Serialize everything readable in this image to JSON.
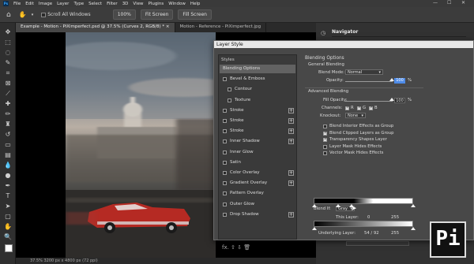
{
  "menubar": {
    "logo": "Ps",
    "items": [
      "File",
      "Edit",
      "Image",
      "Layer",
      "Type",
      "Select",
      "Filter",
      "3D",
      "View",
      "Plugins",
      "Window",
      "Help"
    ]
  },
  "optbar": {
    "scroll_all_label": "Scroll All Windows",
    "zoom_value": "100%",
    "fit_screen_1": "Fit Screen",
    "fit_screen_2": "Fill Screen"
  },
  "tabs": [
    {
      "label": "Example - Motion - PiXimperfect.psd @ 37.5% (Curves 2, RGB/8) * ×"
    },
    {
      "label": "Motion - Reference - PiXimperfect.jpg"
    }
  ],
  "statusbar": {
    "text": "37.5%    3200 px x 4800 px (72 ppi)"
  },
  "panel": {
    "navigator_label": "Navigator"
  },
  "dialog": {
    "title": "Layer Style",
    "styles_header": "Styles",
    "styles": [
      {
        "label": "Blending Options",
        "selected": true,
        "plus": false,
        "sub": false
      },
      {
        "label": "Bevel & Emboss",
        "plus": false,
        "sub": false
      },
      {
        "label": "Contour",
        "plus": false,
        "sub": true
      },
      {
        "label": "Texture",
        "plus": false,
        "sub": true
      },
      {
        "label": "Stroke",
        "plus": true,
        "sub": false
      },
      {
        "label": "Stroke",
        "plus": true,
        "sub": false
      },
      {
        "label": "Stroke",
        "plus": true,
        "sub": false
      },
      {
        "label": "Inner Shadow",
        "plus": true,
        "sub": false
      },
      {
        "label": "Inner Glow",
        "plus": false,
        "sub": false
      },
      {
        "label": "Satin",
        "plus": false,
        "sub": false
      },
      {
        "label": "Color Overlay",
        "plus": true,
        "sub": false
      },
      {
        "label": "Gradient Overlay",
        "plus": true,
        "sub": false
      },
      {
        "label": "Pattern Overlay",
        "plus": false,
        "sub": false
      },
      {
        "label": "Outer Glow",
        "plus": false,
        "sub": false
      },
      {
        "label": "Drop Shadow",
        "plus": true,
        "sub": false
      }
    ],
    "footer": "fx.  ⇧  ⇩        🗑",
    "blend": {
      "header": "Blending Options",
      "general": "General Blending",
      "blend_mode_label": "Blend Mode:",
      "blend_mode_value": "Normal",
      "opacity_label": "Opacity:",
      "opacity_value": "100",
      "opacity_unit": "%",
      "advanced": "Advanced Blending",
      "fill_opacity_label": "Fill Opacity:",
      "fill_opacity_value": "100",
      "fill_opacity_unit": "%",
      "channels_label": "Channels:",
      "ch_r": "R",
      "ch_g": "G",
      "ch_b": "B",
      "knockout_label": "Knockout:",
      "knockout_value": "None",
      "options": [
        {
          "label": "Blend Interior Effects as Group",
          "checked": false
        },
        {
          "label": "Blend Clipped Layers as Group",
          "checked": true
        },
        {
          "label": "Transparency Shapes Layer",
          "checked": true
        },
        {
          "label": "Layer Mask Hides Effects",
          "checked": false
        },
        {
          "label": "Vector Mask Hides Effects",
          "checked": false
        }
      ],
      "blend_if_label": "Blend If:",
      "blend_if_value": "Gray",
      "this_layer_label": "This Layer:",
      "this_layer_low": "0",
      "this_layer_high": "255",
      "underlying_label": "Underlying Layer:",
      "underlying_values": "54  /  92",
      "underlying_high": "255"
    }
  },
  "logo_text": "Pi"
}
